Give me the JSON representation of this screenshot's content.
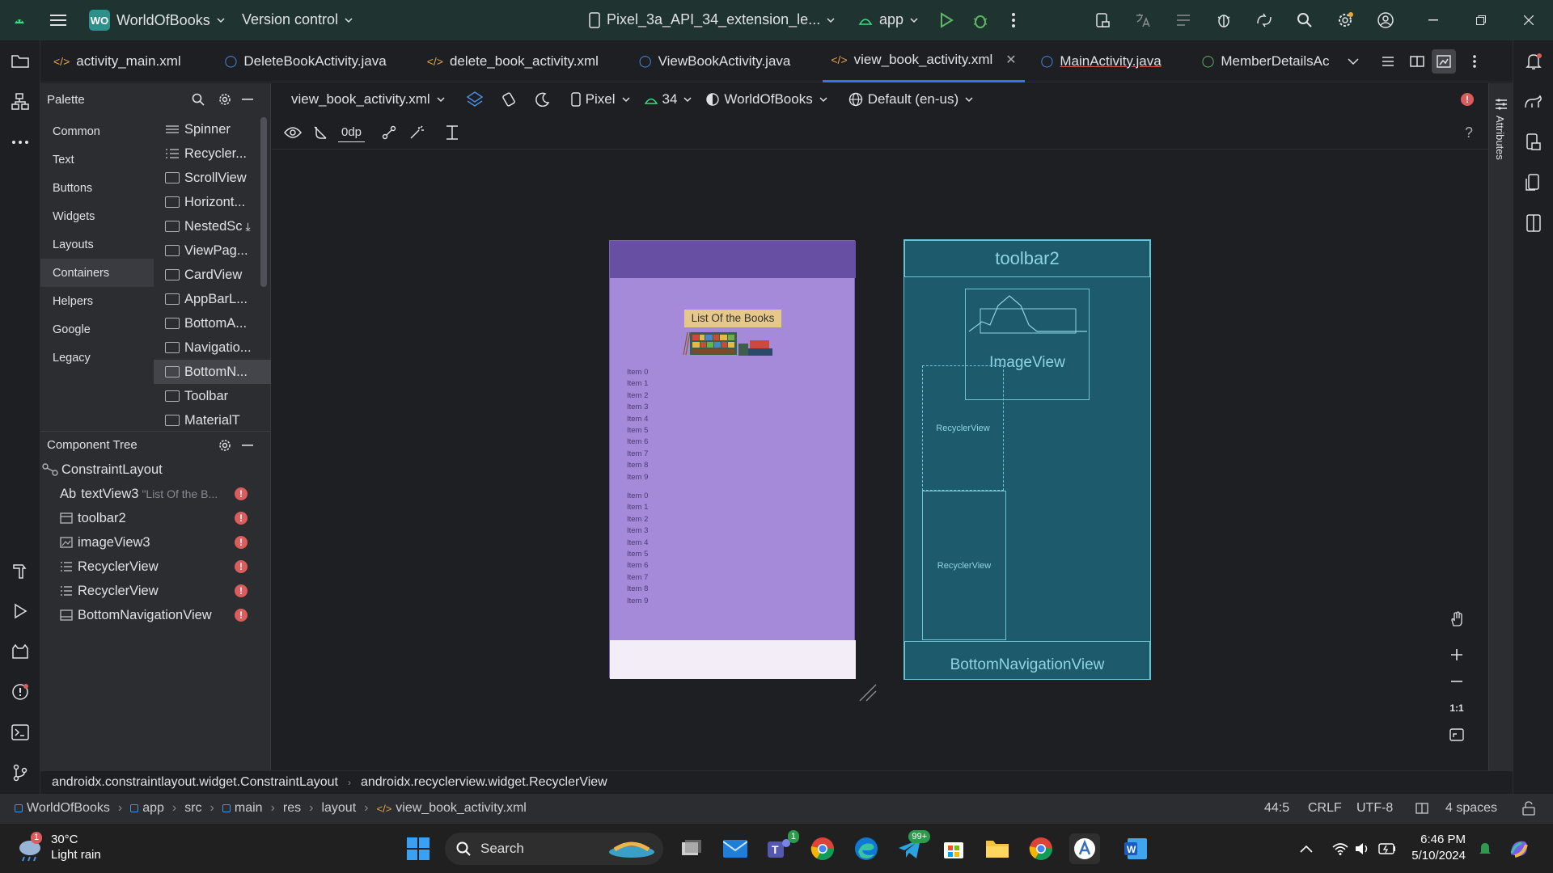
{
  "titlebar": {
    "project_badge": "WO",
    "project_name": "WorldOfBooks",
    "vcs": "Version control",
    "device": "Pixel_3a_API_34_extension_le...",
    "run_config": "app"
  },
  "tabs": [
    {
      "label": "activity_main.xml",
      "type": "xml"
    },
    {
      "label": "DeleteBookActivity.java",
      "type": "java"
    },
    {
      "label": "delete_book_activity.xml",
      "type": "xml"
    },
    {
      "label": "ViewBookActivity.java",
      "type": "java"
    },
    {
      "label": "view_book_activity.xml",
      "type": "xml",
      "active": true
    },
    {
      "label": "MainActivity.java",
      "type": "java"
    },
    {
      "label": "MemberDetailsAc",
      "type": "interface"
    }
  ],
  "palette": {
    "title": "Palette",
    "categories": [
      "Common",
      "Text",
      "Buttons",
      "Widgets",
      "Layouts",
      "Containers",
      "Helpers",
      "Google",
      "Legacy"
    ],
    "selected_category": "Containers",
    "items": [
      "Spinner",
      "Recycler...",
      "ScrollView",
      "Horizont...",
      "NestedSc",
      "ViewPag...",
      "CardView",
      "AppBarL...",
      "BottomA...",
      "Navigatio...",
      "BottomN...",
      "Toolbar",
      "MaterialT"
    ]
  },
  "component_tree": {
    "title": "Component Tree",
    "root": "ConstraintLayout",
    "children": [
      {
        "label": "textView3",
        "prefix": "Ab",
        "hint": "\"List Of the B...",
        "icon": "text-icon"
      },
      {
        "label": "toolbar2",
        "icon": "toolbar-icon"
      },
      {
        "label": "imageView3",
        "icon": "image-icon"
      },
      {
        "label": "RecyclerView",
        "icon": "list-icon"
      },
      {
        "label": "RecyclerView",
        "icon": "list-icon"
      },
      {
        "label": "BottomNavigationView",
        "icon": "bottomnav-icon"
      }
    ]
  },
  "design_toolbar": {
    "file": "view_book_activity.xml",
    "device": "Pixel",
    "api": "34",
    "theme": "WorldOfBooks",
    "locale": "Default (en-us)",
    "margin": "0dp"
  },
  "attributes_label": "Attributes",
  "phone_preview": {
    "title_text": "List Of the Books",
    "list1": [
      "Item 0",
      "Item 1",
      "Item 2",
      "Item 3",
      "Item 4",
      "Item 5",
      "Item 6",
      "Item 7",
      "Item 8",
      "Item 9"
    ],
    "list2": [
      "Item 0",
      "Item 1",
      "Item 2",
      "Item 3",
      "Item 4",
      "Item 5",
      "Item 6",
      "Item 7",
      "Item 8",
      "Item 9"
    ]
  },
  "blueprint": {
    "toolbar": "toolbar2",
    "image": "ImageView",
    "recycler1": "RecyclerView",
    "recycler2": "RecyclerView",
    "bottomnav": "BottomNavigationView"
  },
  "zoom": {
    "fit": "1:1"
  },
  "crumb": [
    "androidx.constraintlayout.widget.ConstraintLayout",
    "androidx.recyclerview.widget.RecyclerView"
  ],
  "status": {
    "path": [
      "WorldOfBooks",
      "app",
      "src",
      "main",
      "res",
      "layout",
      "view_book_activity.xml"
    ],
    "position": "44:5",
    "line_sep": "CRLF",
    "encoding": "UTF-8",
    "indent": "4 spaces"
  },
  "taskbar": {
    "weather_temp": "30°C",
    "weather_desc": "Light rain",
    "weather_badge": "1",
    "search": "Search",
    "teams_badge": "1",
    "telegram_badge": "99+",
    "time": "6:46 PM",
    "date": "5/10/2024"
  },
  "colors": {
    "accent": "#3574f0",
    "error": "#db5c5c",
    "phone_top": "#6750a4",
    "phone_body": "#a58ad9",
    "blueprint": "#1d5a6b"
  }
}
